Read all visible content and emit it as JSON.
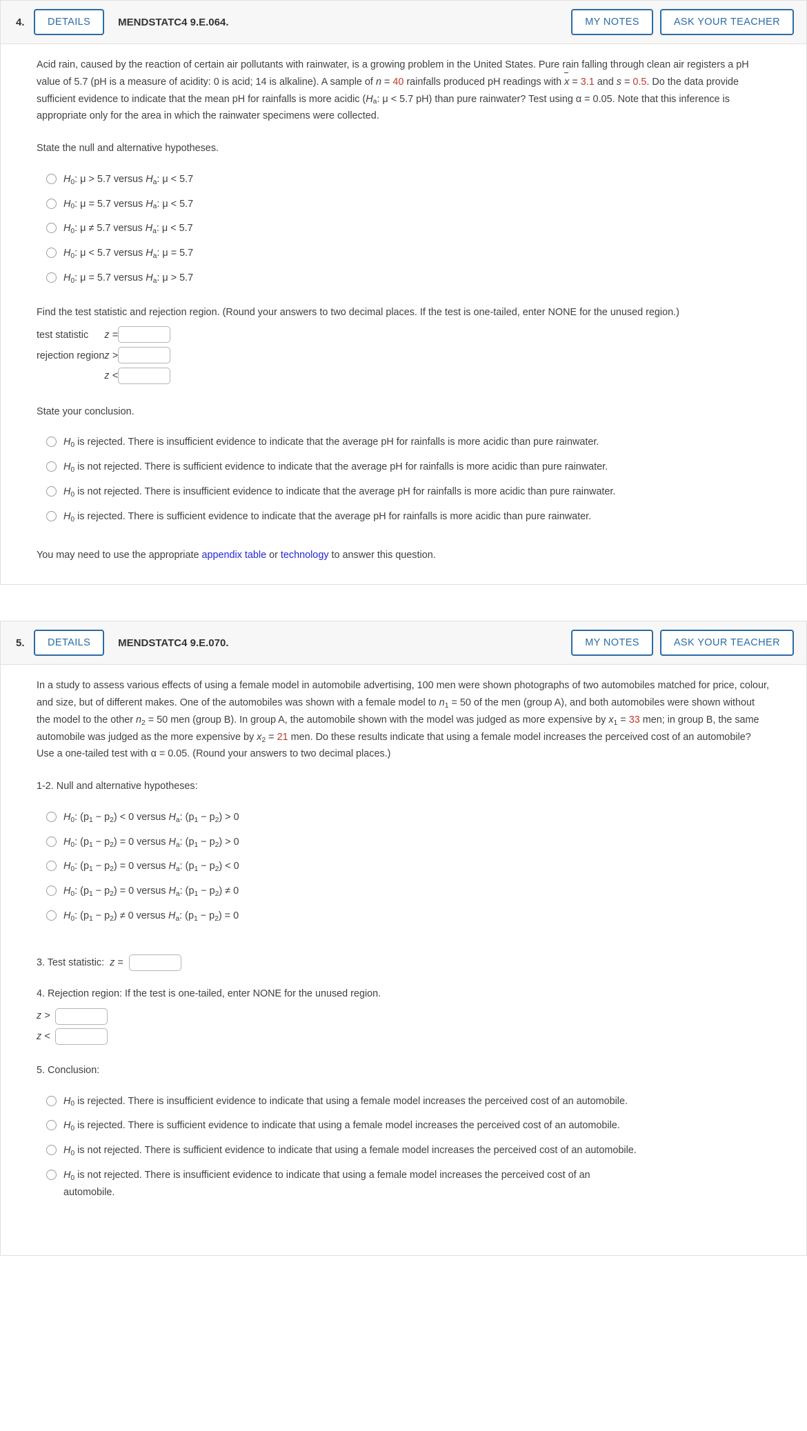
{
  "questions": [
    {
      "number": "4.",
      "details_label": "DETAILS",
      "title": "MENDSTATC4 9.E.064.",
      "my_notes_label": "MY NOTES",
      "ask_teacher_label": "ASK YOUR TEACHER",
      "stem": {
        "part1": "Acid rain, caused by the reaction of certain air pollutants with rainwater, is a growing problem in the United States. Pure rain falling through clean air registers a pH value of 5.7 (pH is a measure of acidity: 0 is acid; 14 is alkaline). A sample of ",
        "n_symbol": "n",
        "n_eq": " = ",
        "n_value": "40",
        "part2": " rainfalls produced pH readings with ",
        "xbar_symbol": "x",
        "xbar_eq": " = ",
        "xbar_value": "3.1",
        "part3": " and ",
        "s_symbol": "s",
        "s_eq": " = ",
        "s_value": "0.5",
        "part4": ". Do the data provide sufficient evidence to indicate that the mean pH for rainfalls is more acidic (",
        "ha_symbol": "H",
        "ha_sub": "a",
        "ha_rest": ": μ < 5.7 pH) than pure rainwater? Test using α = 0.05. Note that this inference is appropriate only for the area in which the rainwater specimens were collected."
      },
      "hypotheses_label": "State the null and alternative hypotheses.",
      "hypotheses_options": [
        {
          "h0": "H",
          "h0sub": "0",
          "h0rest": ": μ > 5.7 versus ",
          "ha": "H",
          "hasub": "a",
          "harest": ": μ < 5.7"
        },
        {
          "h0": "H",
          "h0sub": "0",
          "h0rest": ": μ = 5.7 versus ",
          "ha": "H",
          "hasub": "a",
          "harest": ": μ < 5.7"
        },
        {
          "h0": "H",
          "h0sub": "0",
          "h0rest": ": μ ≠ 5.7 versus ",
          "ha": "H",
          "hasub": "a",
          "harest": ": μ < 5.7"
        },
        {
          "h0": "H",
          "h0sub": "0",
          "h0rest": ": μ < 5.7 versus ",
          "ha": "H",
          "hasub": "a",
          "harest": ": μ = 5.7"
        },
        {
          "h0": "H",
          "h0sub": "0",
          "h0rest": ": μ = 5.7 versus ",
          "ha": "H",
          "hasub": "a",
          "harest": ": μ > 5.7"
        }
      ],
      "find_label": "Find the test statistic and rejection region. (Round your answers to two decimal places. If the test is one-tailed, enter NONE for the unused region.)",
      "fields": {
        "test_statistic_label": "test statistic",
        "test_statistic_op": "z =",
        "test_statistic_value": "",
        "rejection_region_label": "rejection region",
        "rejection_gt_op": "z >",
        "rejection_gt_value": "",
        "rejection_lt_op": "z <",
        "rejection_lt_value": ""
      },
      "conclusion_label": "State your conclusion.",
      "conclusion_options": [
        {
          "h": "H",
          "hsub": "0",
          "text": " is rejected. There is insufficient evidence to indicate that the average pH for rainfalls is more acidic than pure rainwater."
        },
        {
          "h": "H",
          "hsub": "0",
          "text": " is not rejected. There is sufficient evidence to indicate that the average pH for rainfalls is more acidic than pure rainwater."
        },
        {
          "h": "H",
          "hsub": "0",
          "text": " is not rejected. There is insufficient evidence to indicate that the average pH for rainfalls is more acidic than pure rainwater."
        },
        {
          "h": "H",
          "hsub": "0",
          "text": " is rejected. There is sufficient evidence to indicate that the average pH for rainfalls is more acidic than pure rainwater."
        }
      ],
      "footer": {
        "pre": "You may need to use the appropriate ",
        "link1": "appendix table",
        "mid": " or ",
        "link2": "technology",
        "post": " to answer this question."
      }
    },
    {
      "number": "5.",
      "details_label": "DETAILS",
      "title": "MENDSTATC4 9.E.070.",
      "my_notes_label": "MY NOTES",
      "ask_teacher_label": "ASK YOUR TEACHER",
      "stem": {
        "part1": "In a study to assess various effects of using a female model in automobile advertising, 100 men were shown photographs of two automobiles matched for price, colour, and size, but of different makes. One of the automobiles was shown with a female model to ",
        "n1_symbol": "n",
        "n1_sub": "1",
        "n1_eq": " = 50",
        "part2": " of the men (group A), and both automobiles were shown without the model to the other ",
        "n2_symbol": "n",
        "n2_sub": "2",
        "n2_eq": " = 50",
        "part3": " men (group B). In group A, the automobile shown with the model was judged as more expensive by ",
        "x1_symbol": "x",
        "x1_sub": "1",
        "x1_eq": " = ",
        "x1_value": "33",
        "part4": " men; in group B, the same automobile was judged as the more expensive by ",
        "x2_symbol": "x",
        "x2_sub": "2",
        "x2_eq": " = ",
        "x2_value": "21",
        "part5": " men. Do these results indicate that using a female model increases the perceived cost of an automobile? Use a one-tailed test with α = 0.05. (Round your answers to two decimal places.)"
      },
      "hypotheses_label": "1-2. Null and alternative hypotheses:",
      "hypotheses_options": [
        {
          "h0": "H",
          "h0sub": "0",
          "h0rest": ": (p",
          "h0s1": "1",
          "h0mid": " − p",
          "h0s2": "2",
          "h0end": ") < 0 versus ",
          "ha": "H",
          "hasub": "a",
          "harest": ": (p",
          "has1": "1",
          "hamid": " − p",
          "has2": "2",
          "haend": ") > 0"
        },
        {
          "h0": "H",
          "h0sub": "0",
          "h0rest": ": (p",
          "h0s1": "1",
          "h0mid": " − p",
          "h0s2": "2",
          "h0end": ") = 0 versus ",
          "ha": "H",
          "hasub": "a",
          "harest": ": (p",
          "has1": "1",
          "hamid": " − p",
          "has2": "2",
          "haend": ") > 0"
        },
        {
          "h0": "H",
          "h0sub": "0",
          "h0rest": ": (p",
          "h0s1": "1",
          "h0mid": " − p",
          "h0s2": "2",
          "h0end": ") = 0 versus ",
          "ha": "H",
          "hasub": "a",
          "harest": ": (p",
          "has1": "1",
          "hamid": " − p",
          "has2": "2",
          "haend": ") < 0"
        },
        {
          "h0": "H",
          "h0sub": "0",
          "h0rest": ": (p",
          "h0s1": "1",
          "h0mid": " − p",
          "h0s2": "2",
          "h0end": ") = 0 versus ",
          "ha": "H",
          "hasub": "a",
          "harest": ": (p",
          "has1": "1",
          "hamid": " − p",
          "has2": "2",
          "haend": ") ≠ 0"
        },
        {
          "h0": "H",
          "h0sub": "0",
          "h0rest": ": (p",
          "h0s1": "1",
          "h0mid": " − p",
          "h0s2": "2",
          "h0end": ") ≠ 0 versus ",
          "ha": "H",
          "hasub": "a",
          "harest": ": (p",
          "has1": "1",
          "hamid": " − p",
          "has2": "2",
          "haend": ") = 0"
        }
      ],
      "test_statistic": {
        "label": "3. Test statistic:",
        "op": "z =",
        "value": ""
      },
      "rejection_region": {
        "label": "4. Rejection region:  If the test is one-tailed, enter NONE for the unused region.",
        "gt_op": "z >",
        "gt_value": "",
        "lt_op": "z <",
        "lt_value": ""
      },
      "conclusion_label": "5. Conclusion:",
      "conclusion_options": [
        {
          "h": "H",
          "hsub": "0",
          "text": " is rejected. There is insufficient evidence to indicate that using a female model increases the perceived cost of an automobile."
        },
        {
          "h": "H",
          "hsub": "0",
          "text": " is rejected. There is sufficient evidence to indicate that using a female model increases the perceived cost of an automobile."
        },
        {
          "h": "H",
          "hsub": "0",
          "text": " is not rejected. There is sufficient evidence to indicate that using a female model increases the perceived cost of an automobile."
        },
        {
          "h": "H",
          "hsub": "0",
          "text": " is not rejected. There is insufficient evidence to indicate that using a female model increases the perceived cost of an automobile."
        }
      ]
    }
  ],
  "colors": {
    "accent": "#2c6ba3",
    "highlight": "#c0392b",
    "link": "#2626d6"
  }
}
